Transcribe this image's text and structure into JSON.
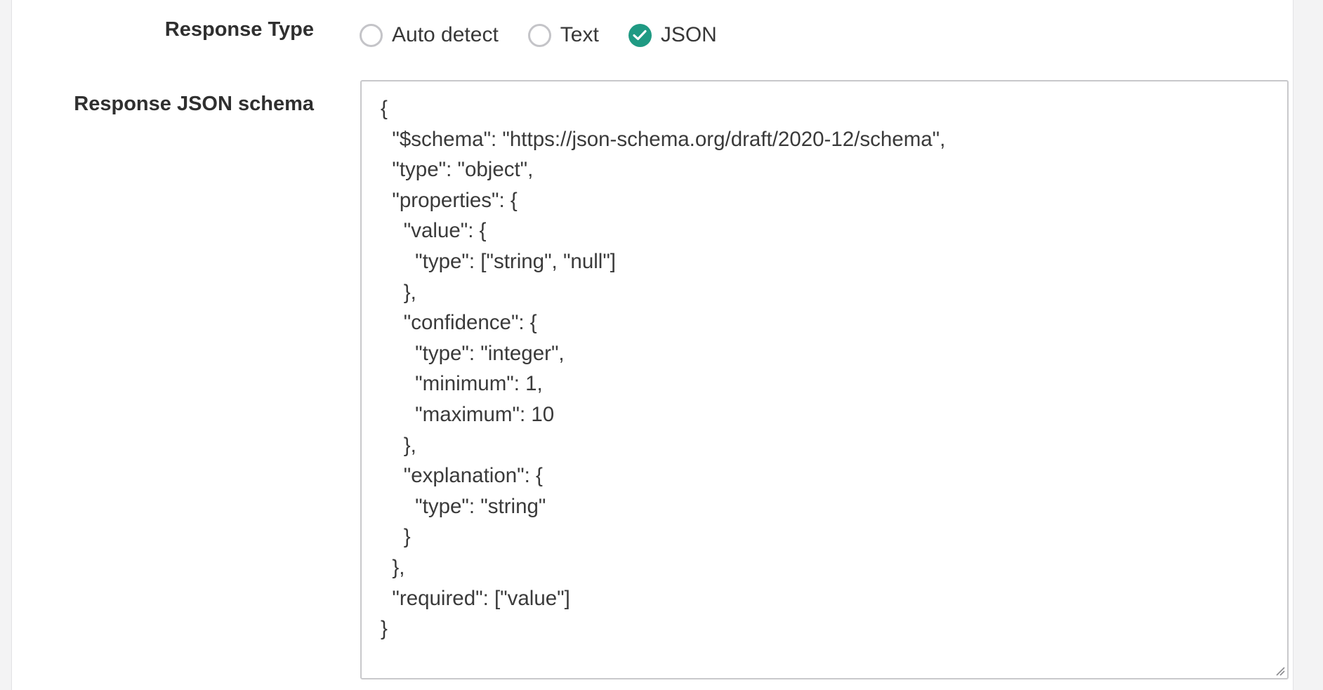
{
  "form": {
    "response_type": {
      "label": "Response Type",
      "options": [
        {
          "label": "Auto detect",
          "selected": false
        },
        {
          "label": "Text",
          "selected": false
        },
        {
          "label": "JSON",
          "selected": true
        }
      ]
    },
    "schema": {
      "label": "Response JSON schema",
      "value": "{\n  \"$schema\": \"https://json-schema.org/draft/2020-12/schema\",\n  \"type\": \"object\",\n  \"properties\": {\n    \"value\": {\n      \"type\": [\"string\", \"null\"]\n    },\n    \"confidence\": {\n      \"type\": \"integer\",\n      \"minimum\": 1,\n      \"maximum\": 10\n    },\n    \"explanation\": {\n      \"type\": \"string\"\n    }\n  },\n  \"required\": [\"value\"]\n}"
    }
  },
  "colors": {
    "accent": "#1f9a83",
    "radio_border": "#c4c4c8",
    "input_border": "#c9c9cc",
    "rail_background": "#f3f3f4"
  },
  "icons": {
    "checked": "checkmark-icon",
    "resize": "resize-grip-icon"
  }
}
